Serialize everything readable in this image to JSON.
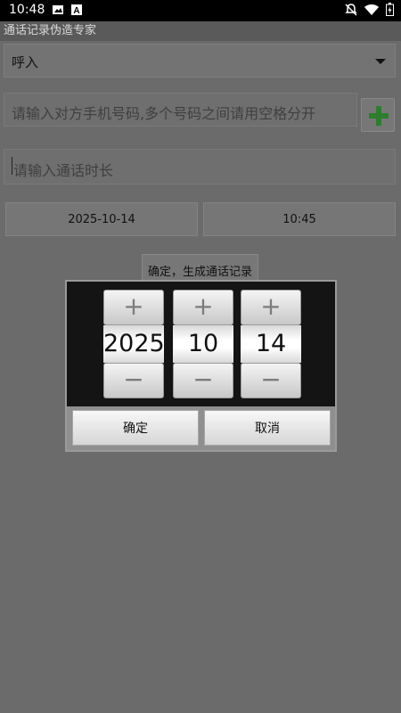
{
  "status_bar": {
    "time": "10:48",
    "left_icons": [
      "image-icon",
      "a-icon"
    ],
    "right_icons": [
      "notifications-off-icon",
      "wifi-icon",
      "battery-icon"
    ]
  },
  "app": {
    "title": "通话记录伪造专家"
  },
  "form": {
    "call_type": "呼入",
    "phone_placeholder": "请输入对方手机号码,多个号码之间请用空格分开",
    "duration_placeholder": "请输入通话时长",
    "date_value": "2025-10-14",
    "time_value": "10:45",
    "submit_label": "确定，生成通话记录"
  },
  "date_dialog": {
    "year": "2025",
    "month": "10",
    "day": "14",
    "increment_symbol": "+",
    "decrement_symbol": "−",
    "confirm_label": "确定",
    "cancel_label": "取消"
  },
  "colors": {
    "accent_green": "#2e7d2e",
    "scrim": "#6b6b6b"
  }
}
